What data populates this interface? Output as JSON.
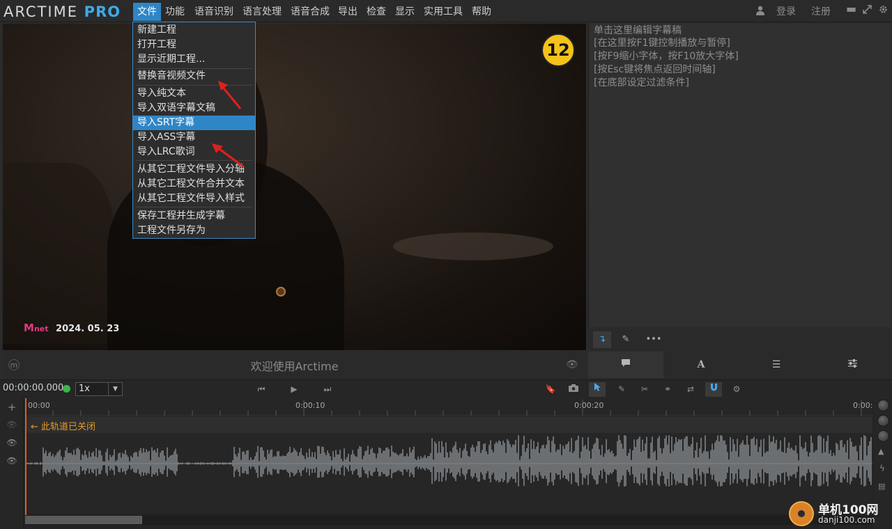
{
  "app": {
    "logo_main": "ARCTIME",
    "logo_pro": "PRO"
  },
  "menubar": {
    "items": [
      "文件",
      "功能",
      "语音识别",
      "语言处理",
      "语音合成",
      "导出",
      "检查",
      "显示",
      "实用工具",
      "帮助"
    ],
    "login": "登录",
    "register": "注册"
  },
  "file_menu": {
    "items": [
      "新建工程",
      "打开工程",
      "显示近期工程...",
      "替换音视频文件",
      "导入纯文本",
      "导入双语字幕文稿",
      "导入SRT字幕",
      "导入ASS字幕",
      "导入LRC歌词",
      "从其它工程文件导入分轴",
      "从其它工程文件合并文本",
      "从其它工程文件导入样式",
      "保存工程并生成字幕",
      "工程文件另存为"
    ],
    "highlighted": "导入SRT字幕"
  },
  "video": {
    "watermark_brand": "M",
    "watermark_brand_suffix": "net",
    "watermark_date": "2024. 05. 23",
    "step_badge": "12"
  },
  "editor_hints": {
    "lines": [
      "单击这里编辑字幕稿",
      "[在这里按F1键控制播放与暂停]",
      "[按F9缩小字体，按F10放大字体]",
      "[按Esc键将焦点返回时间轴]",
      "[在底部设定过滤条件]"
    ]
  },
  "welcome": {
    "text": "欢迎使用Arctime"
  },
  "transport": {
    "timecode": "00:00:00.000",
    "speed": "1x"
  },
  "timeline": {
    "ruler_labels": [
      "00:00",
      "0:00:10",
      "0:00:20",
      "0:00:"
    ],
    "closed_track_label": "← 此轨道已关闭"
  },
  "site_watermark": {
    "title": "单机100网",
    "url": "danji100.com"
  }
}
